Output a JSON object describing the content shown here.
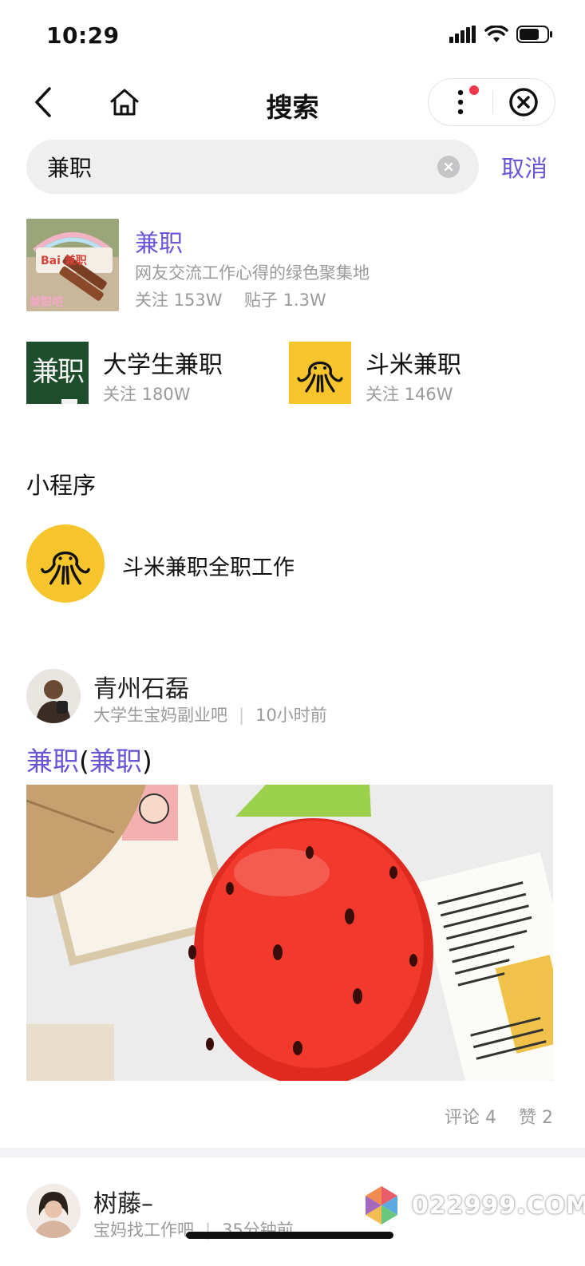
{
  "status_bar": {
    "time": "10:29"
  },
  "nav": {
    "title": "搜索"
  },
  "search": {
    "query": "兼职",
    "cancel_label": "取消"
  },
  "forums": {
    "main": {
      "name": "兼职",
      "description": "网友交流工作心得的绿色聚集地",
      "followers": "关注 153W",
      "posts": "贴子 1.3W",
      "thumb_text": "Bai 兼职",
      "thumb_caption": "兼职吧"
    },
    "related": [
      {
        "name": "大学生兼职",
        "followers": "关注 180W",
        "thumb_text": "兼职"
      },
      {
        "name": "斗米兼职",
        "followers": "关注 146W"
      }
    ]
  },
  "mini_programs": {
    "section_title": "小程序",
    "items": [
      {
        "name": "斗米兼职全职工作"
      }
    ]
  },
  "posts": [
    {
      "author": "青州石磊",
      "forum": "大学生宝妈副业吧",
      "time": "10小时前",
      "title_parts": [
        "兼职",
        "(",
        "兼职",
        ")"
      ],
      "comments": "评论 4",
      "likes": "赞 2"
    },
    {
      "author": "树藤–",
      "forum": "宝妈找工作吧",
      "time": "35分钟前"
    }
  ],
  "watermark": {
    "text": "022999.COM"
  },
  "colors": {
    "accent": "#6a55d6",
    "mini_icon_bg": "#f6c42b",
    "green_board": "#1e4d2b",
    "badge_red": "#f2364b"
  }
}
